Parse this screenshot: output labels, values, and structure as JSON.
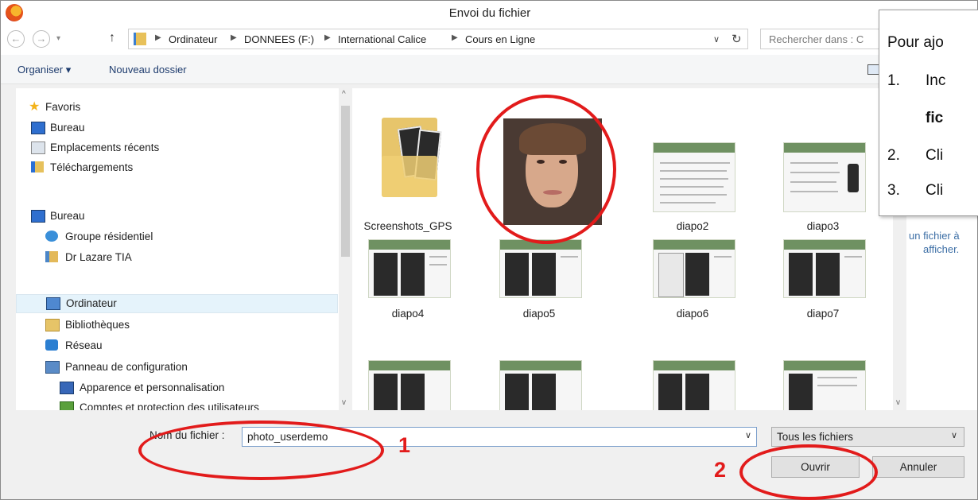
{
  "window": {
    "title": "Envoi du fichier"
  },
  "address_bar": {
    "crumbs": [
      "Ordinateur",
      "DONNEES (F:)",
      "International Calice",
      "Cours en Ligne"
    ],
    "search_placeholder": "Rechercher dans : C"
  },
  "toolbar": {
    "organize_label": "Organiser ▾",
    "new_folder_label": "Nouveau dossier"
  },
  "sidebar": {
    "items": [
      {
        "label": "Favoris",
        "icon": "star-icon"
      },
      {
        "label": "Bureau",
        "icon": "desktop-icon"
      },
      {
        "label": "Emplacements récents",
        "icon": "recent-places-icon"
      },
      {
        "label": "Téléchargements",
        "icon": "downloads-icon"
      },
      {
        "label": "Bureau",
        "icon": "desktop-icon"
      },
      {
        "label": "Groupe résidentiel",
        "icon": "homegroup-icon"
      },
      {
        "label": "Dr Lazare  TIA",
        "icon": "user-folder-icon"
      },
      {
        "label": "Ordinateur",
        "icon": "computer-icon"
      },
      {
        "label": "Bibliothèques",
        "icon": "libraries-icon"
      },
      {
        "label": "Réseau",
        "icon": "network-icon"
      },
      {
        "label": "Panneau de configuration",
        "icon": "control-panel-icon"
      },
      {
        "label": "Apparence et personnalisation",
        "icon": "appearance-icon"
      },
      {
        "label": "Comptes et protection des utilisateurs",
        "icon": "user-accounts-icon"
      }
    ]
  },
  "files": [
    {
      "name": "Screenshots_GPS",
      "kind": "folder"
    },
    {
      "name": "",
      "kind": "photo"
    },
    {
      "name": "diapo2",
      "kind": "slide"
    },
    {
      "name": "diapo3",
      "kind": "slide"
    },
    {
      "name": "diapo4",
      "kind": "slide"
    },
    {
      "name": "diapo5",
      "kind": "slide"
    },
    {
      "name": "diapo6",
      "kind": "slide"
    },
    {
      "name": "diapo7",
      "kind": "slide"
    },
    {
      "name": "",
      "kind": "slide"
    },
    {
      "name": "",
      "kind": "slide"
    },
    {
      "name": "",
      "kind": "slide"
    },
    {
      "name": "",
      "kind": "slide"
    }
  ],
  "preview": {
    "text_line1": "un fichier à",
    "text_line2": "afficher."
  },
  "bottom": {
    "filename_label": "Nom du fichier :",
    "filename_value": "photo_userdemo",
    "filetype_value": "Tous les fichiers",
    "open_label": "Ouvrir",
    "cancel_label": "Annuler"
  },
  "tooltip": {
    "line1": "Pour ajo",
    "n1": "1.",
    "t1": "Inc",
    "t1b": "fic",
    "n2": "2.",
    "t2": "Cli",
    "n3": "3.",
    "t3": "Cli"
  },
  "annotations": {
    "step1": "1",
    "step2": "2"
  },
  "colors": {
    "annotation_red": "#e21b1b",
    "selection_blue": "#e5f3fb",
    "link_blue": "#1e3c6e"
  }
}
